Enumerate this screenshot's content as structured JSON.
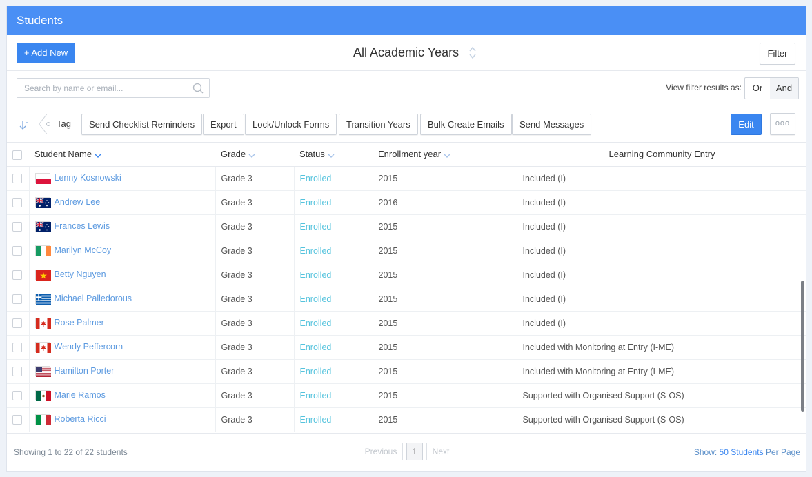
{
  "header": {
    "title": "Students"
  },
  "toolbar": {
    "add_label": "+ Add New",
    "year_label": "All Academic Years",
    "filter_label": "Filter"
  },
  "search": {
    "placeholder": "Search by name or email...",
    "view_label": "View filter results as:",
    "or_label": "Or",
    "and_label": "And"
  },
  "actions": {
    "tag": "Tag",
    "send_reminders": "Send Checklist Reminders",
    "export": "Export",
    "lock_unlock": "Lock/Unlock Forms",
    "transition": "Transition Years",
    "bulk_emails": "Bulk Create Emails",
    "send_messages": "Send Messages",
    "edit": "Edit",
    "more": "ooo"
  },
  "table": {
    "columns": {
      "name": "Student Name",
      "grade": "Grade",
      "status": "Status",
      "year": "Enrollment year",
      "community": "Learning Community Entry"
    },
    "rows": [
      {
        "flag": "poland",
        "name": "Lenny Kosnowski",
        "grade": "Grade 3",
        "status": "Enrolled",
        "year": "2015",
        "community": "Included (I)"
      },
      {
        "flag": "australia",
        "name": "Andrew Lee",
        "grade": "Grade 3",
        "status": "Enrolled",
        "year": "2016",
        "community": "Included (I)"
      },
      {
        "flag": "australia",
        "name": "Frances Lewis",
        "grade": "Grade 3",
        "status": "Enrolled",
        "year": "2015",
        "community": "Included (I)"
      },
      {
        "flag": "ireland",
        "name": "Marilyn McCoy",
        "grade": "Grade 3",
        "status": "Enrolled",
        "year": "2015",
        "community": "Included (I)"
      },
      {
        "flag": "vietnam",
        "name": "Betty Nguyen",
        "grade": "Grade 3",
        "status": "Enrolled",
        "year": "2015",
        "community": "Included (I)"
      },
      {
        "flag": "greece",
        "name": "Michael Palledorous",
        "grade": "Grade 3",
        "status": "Enrolled",
        "year": "2015",
        "community": "Included (I)"
      },
      {
        "flag": "canada",
        "name": "Rose Palmer",
        "grade": "Grade 3",
        "status": "Enrolled",
        "year": "2015",
        "community": "Included (I)"
      },
      {
        "flag": "canada",
        "name": "Wendy Peffercorn",
        "grade": "Grade 3",
        "status": "Enrolled",
        "year": "2015",
        "community": "Included with Monitoring at Entry (I-ME)"
      },
      {
        "flag": "usa",
        "name": "Hamilton Porter",
        "grade": "Grade 3",
        "status": "Enrolled",
        "year": "2015",
        "community": "Included with Monitoring at Entry (I-ME)"
      },
      {
        "flag": "mexico",
        "name": "Marie Ramos",
        "grade": "Grade 3",
        "status": "Enrolled",
        "year": "2015",
        "community": "Supported with Organised Support (S-OS)"
      },
      {
        "flag": "italy",
        "name": "Roberta Ricci",
        "grade": "Grade 3",
        "status": "Enrolled",
        "year": "2015",
        "community": "Supported with Organised Support (S-OS)"
      }
    ]
  },
  "footer": {
    "showing": "Showing 1 to 22 of 22 students",
    "prev": "Previous",
    "page": "1",
    "next": "Next",
    "show_prefix": "Show:",
    "show_count": "50 Students",
    "show_suffix": "Per Page"
  },
  "colors": {
    "header_bg": "#4a8ff5",
    "primary_button": "#3a86f0",
    "link": "#5c9ae0",
    "status": "#55c3dd"
  }
}
